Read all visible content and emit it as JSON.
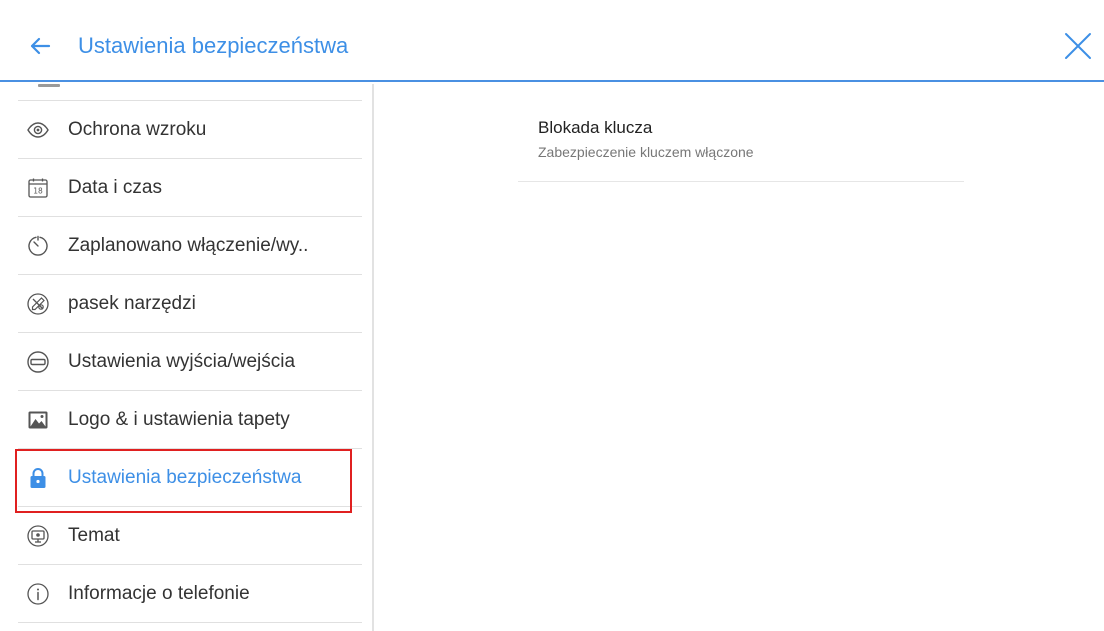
{
  "header": {
    "title": "Ustawienia bezpieczeństwa",
    "back_icon": "arrow-left-icon",
    "close_icon": "close-icon"
  },
  "sidebar": {
    "items": [
      {
        "label": "Ochrona wzroku",
        "icon": "eye-icon",
        "active": false
      },
      {
        "label": "Data i czas",
        "icon": "calendar-icon",
        "active": false
      },
      {
        "label": "Zaplanowano włączenie/wy..",
        "icon": "timer-icon",
        "active": false
      },
      {
        "label": "pasek narzędzi",
        "icon": "tools-icon",
        "active": false
      },
      {
        "label": "Ustawienia wyjścia/wejścia",
        "icon": "input-output-icon",
        "active": false
      },
      {
        "label": "Logo & i ustawienia tapety",
        "icon": "image-icon",
        "active": false
      },
      {
        "label": "Ustawienia bezpieczeństwa",
        "icon": "lock-icon",
        "active": true
      },
      {
        "label": "Temat",
        "icon": "theme-icon",
        "active": false
      },
      {
        "label": "Informacje o telefonie",
        "icon": "info-icon",
        "active": false
      }
    ]
  },
  "content": {
    "setting": {
      "title": "Blokada klucza",
      "subtitle": "Zabezpieczenie kluczem włączone"
    }
  },
  "colors": {
    "accent": "#3d8fe6",
    "highlight_border": "#e02020",
    "divider": "#e0e0e0"
  }
}
